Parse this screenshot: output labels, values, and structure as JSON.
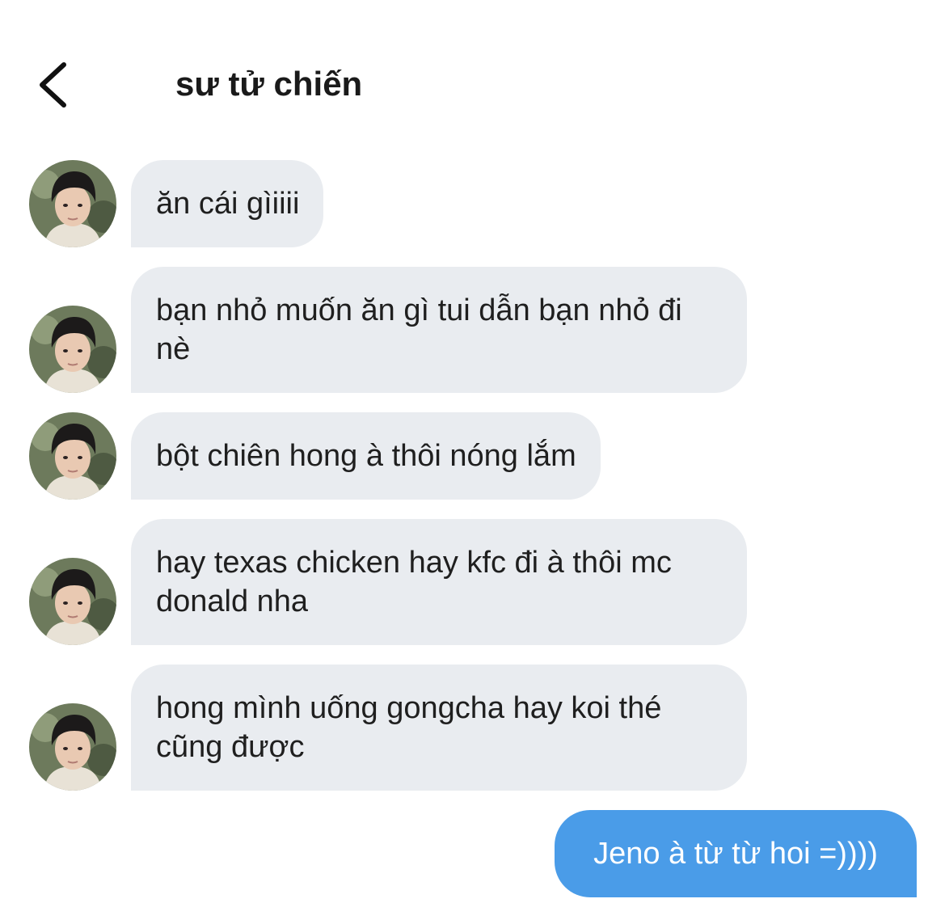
{
  "header": {
    "title": "sư tử chiến",
    "back_icon": "chevron-left-icon"
  },
  "messages": [
    {
      "from": "other",
      "text": "ăn cái gìiiii"
    },
    {
      "from": "other",
      "text": "bạn nhỏ muốn ăn gì tui dẫn bạn nhỏ đi nè"
    },
    {
      "from": "other",
      "text": "bột chiên hong à thôi nóng lắm"
    },
    {
      "from": "other",
      "text": "hay texas chicken hay kfc đi à thôi mc donald nha"
    },
    {
      "from": "other",
      "text": "hong mình uống gongcha hay koi thé cũng được"
    },
    {
      "from": "me",
      "text": "Jeno à từ từ hoi =))))"
    }
  ],
  "colors": {
    "incoming_bubble": "#e9ecf0",
    "outgoing_bubble": "#4a9ce8",
    "incoming_text": "#1f1f1f",
    "outgoing_text": "#ffffff"
  }
}
